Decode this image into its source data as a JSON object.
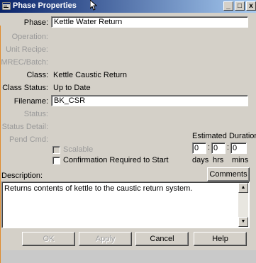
{
  "window": {
    "title": "Phase Properties",
    "minimize_glyph": "_",
    "maximize_glyph": "□",
    "close_glyph": "x"
  },
  "form": {
    "phase": {
      "label": "Phase:",
      "value": "Kettle Water Return"
    },
    "operation": {
      "label": "Operation:"
    },
    "unit_recipe": {
      "label": "Unit Recipe:"
    },
    "mrec_batch": {
      "label": "MREC/Batch:"
    },
    "class": {
      "label": "Class:",
      "value": "Kettle Caustic Return"
    },
    "class_status": {
      "label": "Class Status:",
      "value": "Up to Date"
    },
    "filename": {
      "label": "Filename:",
      "value": "BK_CSR"
    },
    "status": {
      "label": "Status:"
    },
    "status_detail": {
      "label": "Status Detail:"
    },
    "pend_cmd": {
      "label": "Pend Cmd:"
    }
  },
  "options": {
    "scalable": {
      "label": "Scalable",
      "checked": false,
      "enabled": false
    },
    "confirmation": {
      "label": "Confirmation Required to Start",
      "checked": false
    }
  },
  "duration": {
    "label": "Estimated Duration:",
    "days": "0",
    "hrs": "0",
    "mins": "0",
    "sep": ":",
    "days_label": "days",
    "hrs_label": "hrs",
    "mins_label": "mins"
  },
  "description": {
    "label": "Description:",
    "comments_button": "Comments",
    "text": "Returns contents of kettle to the caustic return system."
  },
  "buttons": {
    "ok": "OK",
    "apply": "Apply",
    "cancel": "Cancel",
    "help": "Help"
  },
  "colors": {
    "title_start": "#0a246a",
    "title_end": "#a6caf0",
    "face": "#d4d0c8"
  }
}
